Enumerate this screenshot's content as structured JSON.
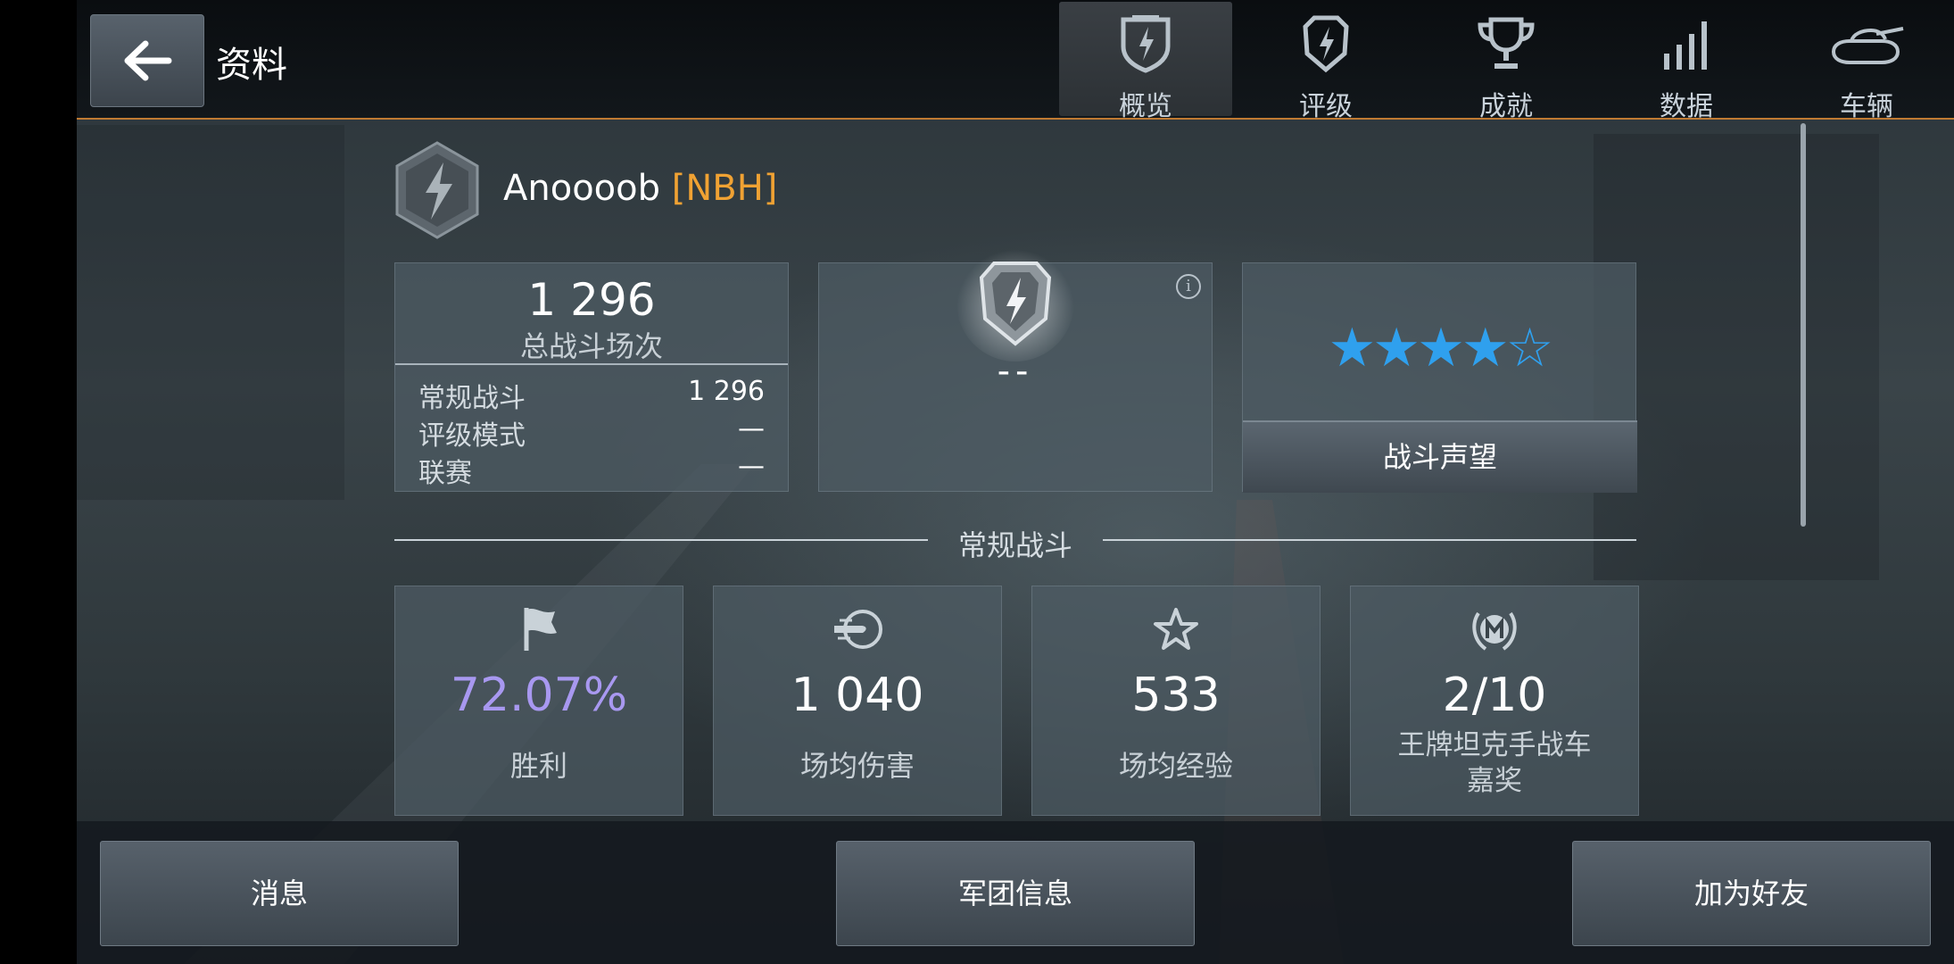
{
  "header": {
    "title": "资料",
    "tabs": [
      {
        "label": "概览",
        "icon": "shield-overview-icon",
        "active": true
      },
      {
        "label": "评级",
        "icon": "rating-shield-icon",
        "active": false
      },
      {
        "label": "成就",
        "icon": "trophy-icon",
        "active": false
      },
      {
        "label": "数据",
        "icon": "bar-signal-icon",
        "active": false
      },
      {
        "label": "车辆",
        "icon": "tank-icon",
        "active": false
      }
    ],
    "accent_color": "#c07a32"
  },
  "player": {
    "name": "Anoooob",
    "clan": "[NBH]",
    "clan_color": "#f0a233"
  },
  "battles": {
    "total": "1 296",
    "total_label": "总战斗场次",
    "rows": [
      {
        "label": "常规战斗",
        "value": "1 296"
      },
      {
        "label": "评级模式",
        "value": "—"
      },
      {
        "label": "联赛",
        "value": "—"
      }
    ]
  },
  "rating": {
    "value": "--",
    "info_symbol": "i"
  },
  "reputation": {
    "stars_filled": 4,
    "stars_total": 5,
    "stars_text": "★★★★☆",
    "star_color": "#2fa0ee",
    "button_label": "战斗声望"
  },
  "section": {
    "title": "常规战斗"
  },
  "stats": [
    {
      "icon": "flag-icon",
      "value": "72.07%",
      "label": "胜利",
      "value_color": "#a898f0"
    },
    {
      "icon": "shell-damage-icon",
      "value": "1 040",
      "label": "场均伤害"
    },
    {
      "icon": "star-outline-icon",
      "value": "533",
      "label": "场均经验"
    },
    {
      "icon": "mastery-badge-icon",
      "value": "2/10",
      "label": "王牌坦克手战车",
      "label2": "嘉奖"
    }
  ],
  "bottom": {
    "messages": "消息",
    "clan_info": "军团信息",
    "add_friend": "加为好友"
  }
}
